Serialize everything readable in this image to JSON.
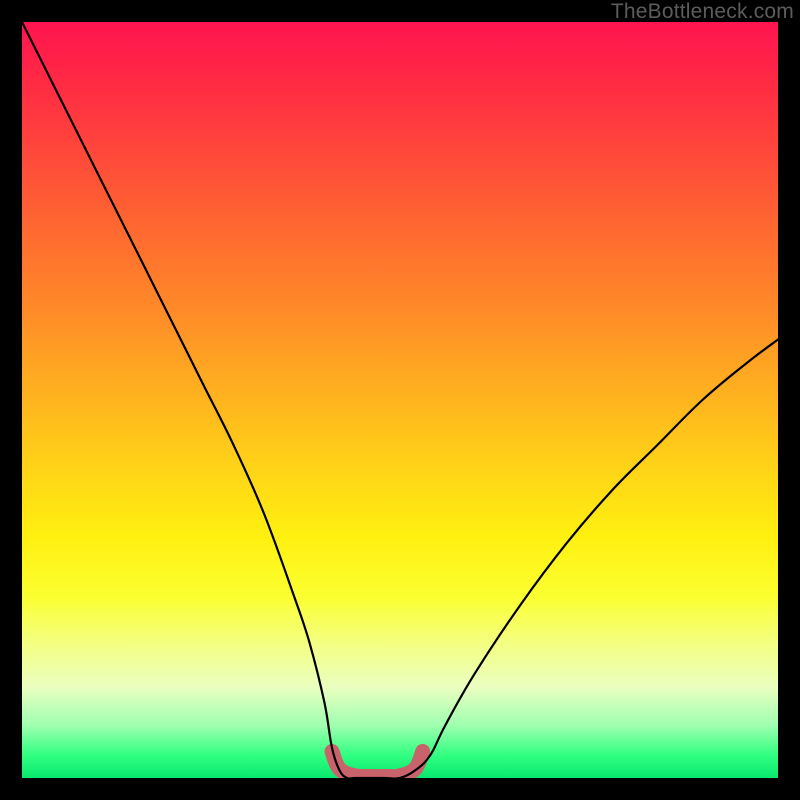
{
  "watermark": "TheBottleneck.com",
  "chart_data": {
    "type": "line",
    "title": "",
    "xlabel": "",
    "ylabel": "",
    "x_range": [
      0,
      100
    ],
    "y_range_percent": [
      0,
      100
    ],
    "note": "Bottleneck percentage curve; y is bottleneck % (0 = ideal at bottom), x is relative hardware balance. No axes shown.",
    "series": [
      {
        "name": "bottleneck-curve",
        "color": "#000000",
        "x": [
          0,
          4,
          8,
          12,
          16,
          20,
          24,
          28,
          32,
          36,
          38,
          40,
          41,
          42,
          43,
          44,
          46,
          48,
          50,
          52,
          54,
          56,
          60,
          66,
          72,
          78,
          84,
          90,
          96,
          100
        ],
        "y": [
          100,
          92,
          84,
          76,
          68,
          60,
          52,
          44,
          35,
          24,
          18,
          10,
          4,
          1,
          0,
          0,
          0,
          0,
          0,
          1,
          3,
          7,
          14,
          23,
          31,
          38,
          44,
          50,
          55,
          58
        ]
      },
      {
        "name": "optimal-band",
        "color": "#c9636b",
        "x": [
          41,
          42,
          44,
          46,
          48,
          50,
          52,
          53
        ],
        "y": [
          3.5,
          1.2,
          0.3,
          0.2,
          0.2,
          0.3,
          1.2,
          3.5
        ]
      }
    ]
  }
}
